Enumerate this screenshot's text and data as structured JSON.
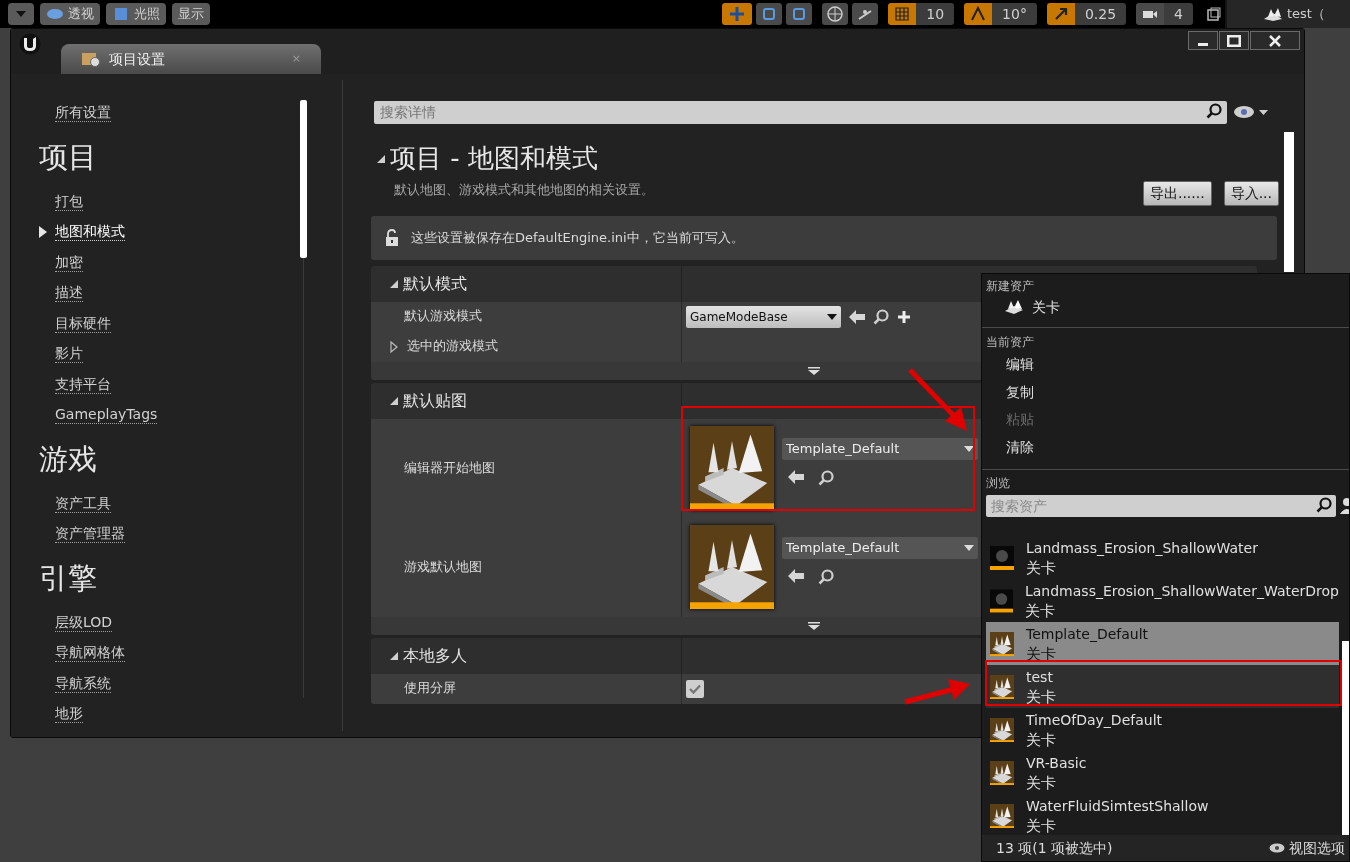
{
  "viewport_toolbar": {
    "buttons": [
      {
        "label": "透视"
      },
      {
        "label": "光照"
      },
      {
        "label": "显示"
      }
    ],
    "snap_values": [
      {
        "kind": "grid",
        "value": "10"
      },
      {
        "kind": "angle",
        "value": "10°"
      },
      {
        "kind": "scale",
        "value": "0.25"
      },
      {
        "kind": "camera",
        "value": "4"
      }
    ],
    "outliner_item": "test（"
  },
  "window": {
    "tab": "项目设置",
    "tab_close": "×"
  },
  "sidebar": {
    "items": [
      {
        "kind": "link",
        "label": "所有设置",
        "selected": false
      },
      {
        "kind": "heading",
        "label": "项目"
      },
      {
        "kind": "link",
        "label": "打包",
        "selected": false
      },
      {
        "kind": "link",
        "label": "地图和模式",
        "selected": true
      },
      {
        "kind": "link",
        "label": "加密",
        "selected": false
      },
      {
        "kind": "link",
        "label": "描述",
        "selected": false
      },
      {
        "kind": "link",
        "label": "目标硬件",
        "selected": false
      },
      {
        "kind": "link",
        "label": "影片",
        "selected": false
      },
      {
        "kind": "link",
        "label": "支持平台",
        "selected": false
      },
      {
        "kind": "link",
        "label": "GameplayTags",
        "selected": false
      },
      {
        "kind": "heading",
        "label": "游戏"
      },
      {
        "kind": "link",
        "label": "资产工具",
        "selected": false
      },
      {
        "kind": "link",
        "label": "资产管理器",
        "selected": false
      },
      {
        "kind": "heading",
        "label": "引擎"
      },
      {
        "kind": "link",
        "label": "层级LOD",
        "selected": false
      },
      {
        "kind": "link",
        "label": "导航网格体",
        "selected": false
      },
      {
        "kind": "link",
        "label": "导航系统",
        "selected": false
      },
      {
        "kind": "link",
        "label": "地形",
        "selected": false
      }
    ]
  },
  "details": {
    "search_placeholder": "搜索详情",
    "title": "项目 - 地图和模式",
    "description": "默认地图、游戏模式和其他地图的相关设置。",
    "buttons": [
      "导出......",
      "导入..."
    ],
    "notice": "这些设置被保存在DefaultEngine.ini中，它当前可写入。",
    "sections": [
      {
        "title": "默认模式",
        "expanded": true,
        "rows": [
          {
            "kind": "class",
            "label": "默认游戏模式",
            "value": "GameModeBase"
          },
          {
            "kind": "group",
            "label": "选中的游戏模式",
            "expanded": false
          }
        ]
      },
      {
        "title": "默认贴图",
        "expanded": true,
        "rows": [
          {
            "kind": "map",
            "label": "编辑器开始地图",
            "value": "Template_Default"
          },
          {
            "kind": "map",
            "label": "游戏默认地图",
            "value": "Template_Default"
          }
        ]
      },
      {
        "title": "本地多人",
        "expanded": true,
        "rows": [
          {
            "kind": "checkbox",
            "label": "使用分屏",
            "checked": true
          }
        ]
      }
    ]
  },
  "asset_menu": {
    "new_heading": "新建资产",
    "new_item": "关卡",
    "current_heading": "当前资产",
    "actions": [
      {
        "label": "编辑",
        "disabled": false
      },
      {
        "label": "复制",
        "disabled": false
      },
      {
        "label": "粘贴",
        "disabled": true
      },
      {
        "label": "清除",
        "disabled": false
      }
    ],
    "browse_heading": "浏览",
    "search_placeholder": "搜索资产",
    "assets": [
      {
        "name": "Landmass_Erosion_ShallowWater",
        "type": "关卡",
        "kind": "sphere",
        "selected": false,
        "hovered": false
      },
      {
        "name": "Landmass_Erosion_ShallowWater_WaterDrop",
        "type": "关卡",
        "kind": "sphere",
        "selected": false,
        "hovered": false
      },
      {
        "name": "Template_Default",
        "type": "关卡",
        "kind": "level",
        "selected": true,
        "hovered": false
      },
      {
        "name": "test",
        "type": "关卡",
        "kind": "level",
        "selected": false,
        "hovered": true
      },
      {
        "name": "TimeOfDay_Default",
        "type": "关卡",
        "kind": "level",
        "selected": false,
        "hovered": false
      },
      {
        "name": "VR-Basic",
        "type": "关卡",
        "kind": "level",
        "selected": false,
        "hovered": false
      },
      {
        "name": "WaterFluidSimtestShallow",
        "type": "关卡",
        "kind": "level",
        "selected": false,
        "hovered": false
      }
    ],
    "status": "13 项(1 项被选中)",
    "view_options": "视图选项"
  }
}
